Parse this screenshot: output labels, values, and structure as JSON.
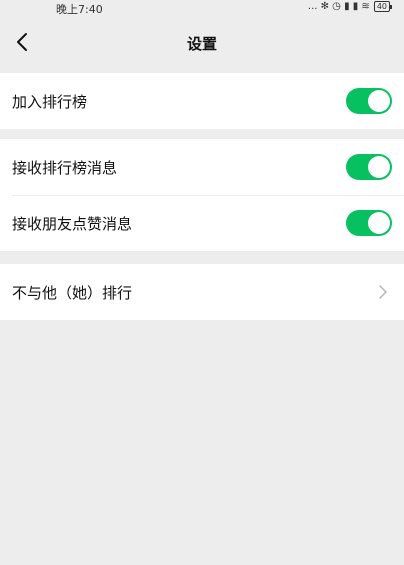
{
  "status_bar": {
    "time": "晚上7:40",
    "icons_text": "... ✻ ◷ ▮ ▮ ≋",
    "battery": "40"
  },
  "nav": {
    "title": "设置",
    "back_icon": "chevron-left-icon"
  },
  "settings": {
    "join_leaderboard": {
      "label": "加入排行榜",
      "enabled": true
    },
    "receive_leaderboard_messages": {
      "label": "接收排行榜消息",
      "enabled": true
    },
    "receive_friend_likes": {
      "label": "接收朋友点赞消息",
      "enabled": true
    },
    "exclude_from_ranking": {
      "label": "不与他（她）排行",
      "icon": "chevron-right-icon"
    }
  },
  "colors": {
    "toggle_on": "#07c160",
    "background": "#ededed",
    "row_background": "#ffffff"
  }
}
